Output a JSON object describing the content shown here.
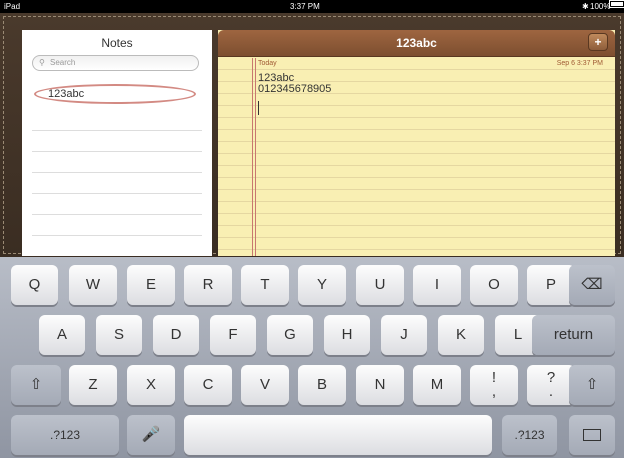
{
  "status": {
    "device": "iPad",
    "time": "3:37 PM",
    "battery": "100%"
  },
  "notes_list": {
    "title": "Notes",
    "search_placeholder": "Search",
    "items": [
      "123abc"
    ]
  },
  "note": {
    "title": "123abc",
    "add_label": "+",
    "today_label": "Today",
    "date_label": "Sep 6  3:37 PM",
    "lines": [
      "123abc",
      "012345678905"
    ]
  },
  "keyboard": {
    "row1": [
      "Q",
      "W",
      "E",
      "R",
      "T",
      "Y",
      "U",
      "I",
      "O",
      "P"
    ],
    "row2": [
      "A",
      "S",
      "D",
      "F",
      "G",
      "H",
      "J",
      "K",
      "L"
    ],
    "row3": [
      "Z",
      "X",
      "C",
      "V",
      "B",
      "N",
      "M"
    ],
    "punct1_top": "!",
    "punct1_bottom": ",",
    "punct2_top": "?",
    "punct2_bottom": ".",
    "return_label": "return",
    "numbers_label": ".?123",
    "delete_icon": "backspace-icon",
    "shift_icon": "shift-icon",
    "mic_icon": "microphone-icon",
    "hide_icon": "keyboard-hide-icon"
  }
}
